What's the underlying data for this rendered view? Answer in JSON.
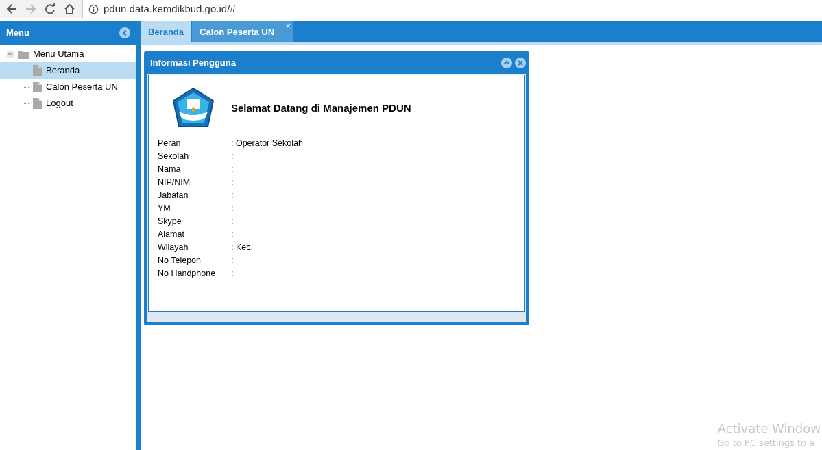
{
  "browser": {
    "url": "pdun.data.kemdikbud.go.id/#"
  },
  "sidebar": {
    "title": "Menu",
    "tree": [
      {
        "label": "Menu Utama",
        "expanded": true,
        "children": [
          {
            "label": "Beranda",
            "selected": true
          },
          {
            "label": "Calon Peserta UN",
            "selected": false
          },
          {
            "label": "Logout",
            "selected": false
          }
        ]
      }
    ]
  },
  "tabs": [
    {
      "label": "Beranda",
      "selected": true,
      "closable": false
    },
    {
      "label": "Calon Peserta UN",
      "selected": false,
      "closable": true,
      "close": "×"
    }
  ],
  "panel": {
    "title": "Informasi Pengguna",
    "heading": "Selamat Datang di Manajemen PDUN",
    "fields": [
      {
        "label": "Peran",
        "value": ": Operator Sekolah"
      },
      {
        "label": "Sekolah",
        "value": ":"
      },
      {
        "label": "Nama",
        "value": ":"
      },
      {
        "label": "NIP/NIM",
        "value": ":"
      },
      {
        "label": "Jabatan",
        "value": ":"
      },
      {
        "label": "YM",
        "value": ":"
      },
      {
        "label": "Skype",
        "value": ":"
      },
      {
        "label": "Alamat",
        "value": ":"
      },
      {
        "label": "Wilayah",
        "value": ": Kec."
      },
      {
        "label": "No Telepon",
        "value": ":"
      },
      {
        "label": "No Handphone",
        "value": ":"
      }
    ]
  },
  "os_notice": {
    "title": "Activate Window",
    "subtitle": "Go to PC settings to a"
  }
}
